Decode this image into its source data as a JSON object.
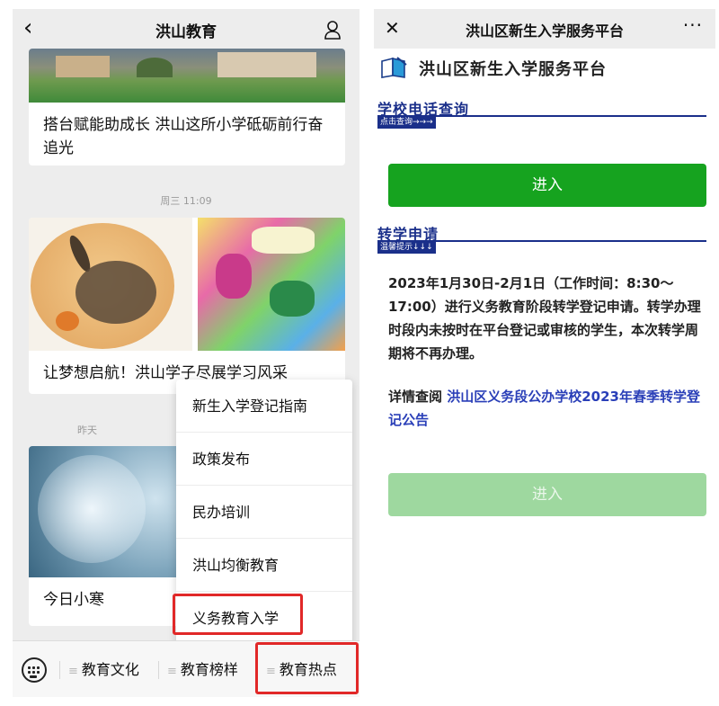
{
  "left": {
    "nav": {
      "back_icon": "back-chevron-icon",
      "title": "洪山教育",
      "user_icon": "user-icon"
    },
    "articles": [
      {
        "title": "搭台赋能助成长 洪山这所小学砥砺前行奋追光"
      },
      {
        "title": "让梦想启航！洪山学子尽展学习风采"
      },
      {
        "title": "今日小寒"
      }
    ],
    "timestamps": [
      "周三 11:09",
      "昨天"
    ],
    "popup_menu": [
      "新生入学登记指南",
      "政策发布",
      "民办培训",
      "洪山均衡教育",
      "义务教育入学"
    ],
    "tabbar": {
      "keyboard_icon": "keyboard-icon",
      "tabs": [
        "教育文化",
        "教育榜样",
        "教育热点"
      ]
    },
    "highlight_color": "#e12828"
  },
  "right": {
    "nav": {
      "close_icon": "close-icon",
      "title": "洪山区新生入学服务平台",
      "more_icon": "more-dots-icon"
    },
    "header": {
      "logo_icon": "book-logo-icon",
      "title": "洪山区新生入学服务平台"
    },
    "section1": {
      "title": "学校电话查询",
      "tag": "点击查询→→→",
      "button": "进入"
    },
    "section2": {
      "title": "转学申请",
      "tag": "温馨提示↓↓↓",
      "notice": "2023年1月30日-2月1日（工作时间：8:30～17:00）进行义务教育阶段转学登记申请。转学办理时段内未按时在平台登记或审核的学生，本次转学周期将不再办理。",
      "detail_prefix": "详情查阅 ",
      "detail_link": "洪山区义务段公办学校2023年春季转学登记公告",
      "button": "进入"
    },
    "colors": {
      "primary_green": "#16a31f",
      "disabled_green": "#9ed89f",
      "section_blue": "#1a2f8a",
      "link_blue": "#2a3fb8"
    }
  }
}
